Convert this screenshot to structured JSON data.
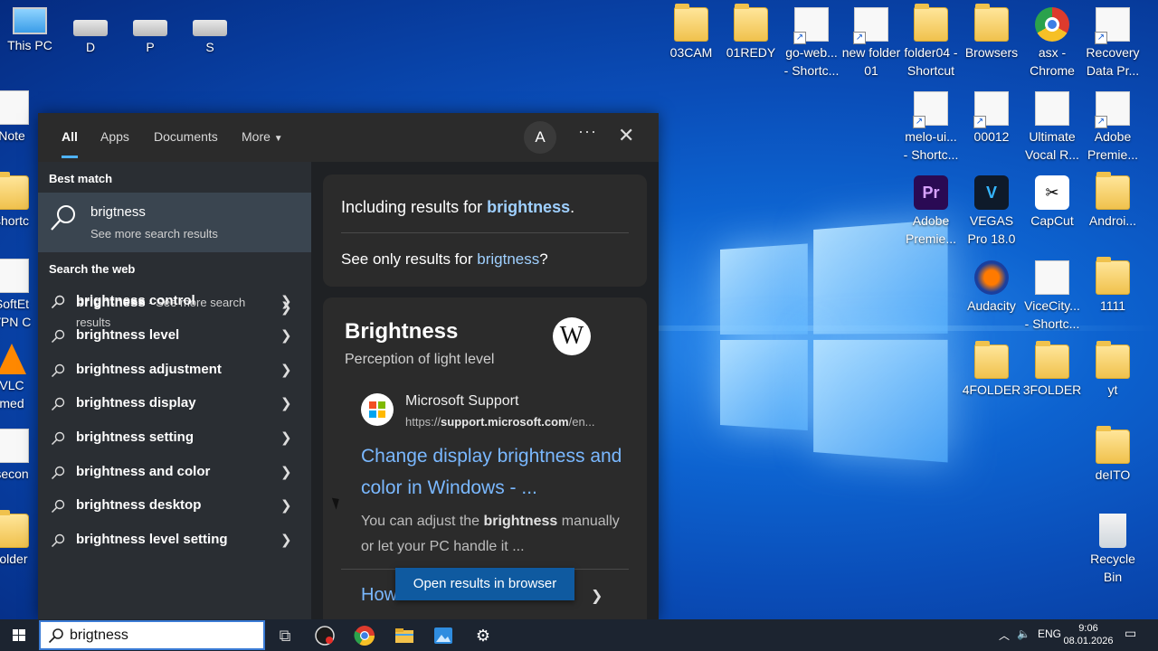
{
  "desktop": {
    "icons_left": [
      {
        "label": "This PC",
        "icon": "monitor-icon"
      },
      {
        "label": "D",
        "icon": "drive-icon"
      },
      {
        "label": "P",
        "icon": "drive-icon"
      },
      {
        "label": "S",
        "icon": "drive-icon"
      },
      {
        "label": "Note",
        "icon": "notepad-icon"
      },
      {
        "label": "shortc",
        "icon": "folder-icon"
      },
      {
        "label": "SoftEt",
        "icon": "app-icon"
      },
      {
        "label": "VPN C",
        "icon": "app-icon"
      },
      {
        "label": "VLC",
        "icon": "vlc-icon"
      },
      {
        "label": "med",
        "icon": "vlc-icon"
      },
      {
        "label": "secon",
        "icon": "audio-icon"
      },
      {
        "label": "folder",
        "icon": "folder-icon"
      }
    ],
    "icons_right": [
      {
        "label": "03CAM",
        "icon": "folder-icon"
      },
      {
        "label": "01REDY",
        "icon": "folder-icon"
      },
      {
        "label": "go-web... - Shortc...",
        "icon": "file-icon"
      },
      {
        "label": "new folder 01",
        "icon": "file-icon"
      },
      {
        "label": "folder04 - Shortcut",
        "icon": "folder-icon"
      },
      {
        "label": "Browsers",
        "icon": "folder-icon"
      },
      {
        "label": "asx - Chrome",
        "icon": "chrome-icon"
      },
      {
        "label": "Recovery Data Pr...",
        "icon": "file-icon"
      },
      {
        "label": "melo-ui... - Shortc...",
        "icon": "file-icon"
      },
      {
        "label": "00012",
        "icon": "file-icon"
      },
      {
        "label": "Ultimate Vocal R...",
        "icon": "app-icon"
      },
      {
        "label": "Adobe Premie...",
        "icon": "file-icon"
      },
      {
        "label": "Adobe Premie...",
        "icon": "premiere-icon"
      },
      {
        "label": "VEGAS Pro 18.0",
        "icon": "vegas-icon"
      },
      {
        "label": "CapCut",
        "icon": "capcut-icon"
      },
      {
        "label": "Androi...",
        "icon": "folder-icon"
      },
      {
        "label": "Audacity",
        "icon": "audacity-icon"
      },
      {
        "label": "ViceCity... - Shortc...",
        "icon": "app-icon"
      },
      {
        "label": "1111",
        "icon": "folder-icon"
      },
      {
        "label": "4FOLDER",
        "icon": "folder-icon"
      },
      {
        "label": "3FOLDER",
        "icon": "folder-icon"
      },
      {
        "label": "yt",
        "icon": "folder-icon"
      },
      {
        "label": "deITO",
        "icon": "folder-icon"
      },
      {
        "label": "Recycle Bin",
        "icon": "recycle-bin-icon"
      }
    ]
  },
  "search": {
    "tabs": [
      "All",
      "Apps",
      "Documents",
      "More"
    ],
    "avatar_letter": "A",
    "more_dots": "···",
    "close": "✕",
    "best_match_heading": "Best match",
    "best_match": {
      "title": "brigtness",
      "subtitle": "See more search results"
    },
    "web_heading": "Search the web",
    "web_first": {
      "term": "brightness",
      "suffix": " - See more search",
      "suffix2": "results"
    },
    "web_suggestions": [
      "brightness control",
      "brightness level",
      "brightness adjustment",
      "brightness display",
      "brightness setting",
      "brightness and color",
      "brightness desktop",
      "brightness level setting"
    ],
    "including_prefix": "Including results for ",
    "including_term": "brightness",
    "including_suffix": ".",
    "see_only_prefix": "See only results for ",
    "see_only_term": "brigtness",
    "see_only_suffix": "?",
    "kp_title": "Brightness",
    "kp_subtitle": "Perception of light level",
    "wiki_letter": "W",
    "source_name": "Microsoft Support",
    "source_url_prefix": "https://",
    "source_url_domain": "support.microsoft.com",
    "source_url_suffix": "/en...",
    "result_title": "Change display brightness and color in Windows - ...",
    "snippet_pre": "You can adjust the ",
    "snippet_bold": "brightness",
    "snippet_post": " manually or let your PC handle it ...",
    "second_result": "How to Color Calibrate...",
    "open_button": "Open results in browser"
  },
  "taskbar": {
    "query": "brigtness",
    "lang": "ENG",
    "time": "9:06",
    "date": "08.01.2026"
  },
  "colors": {
    "accent": "#4fb3ff",
    "link": "#7ab8ff",
    "taskbar": "#1c2430"
  }
}
